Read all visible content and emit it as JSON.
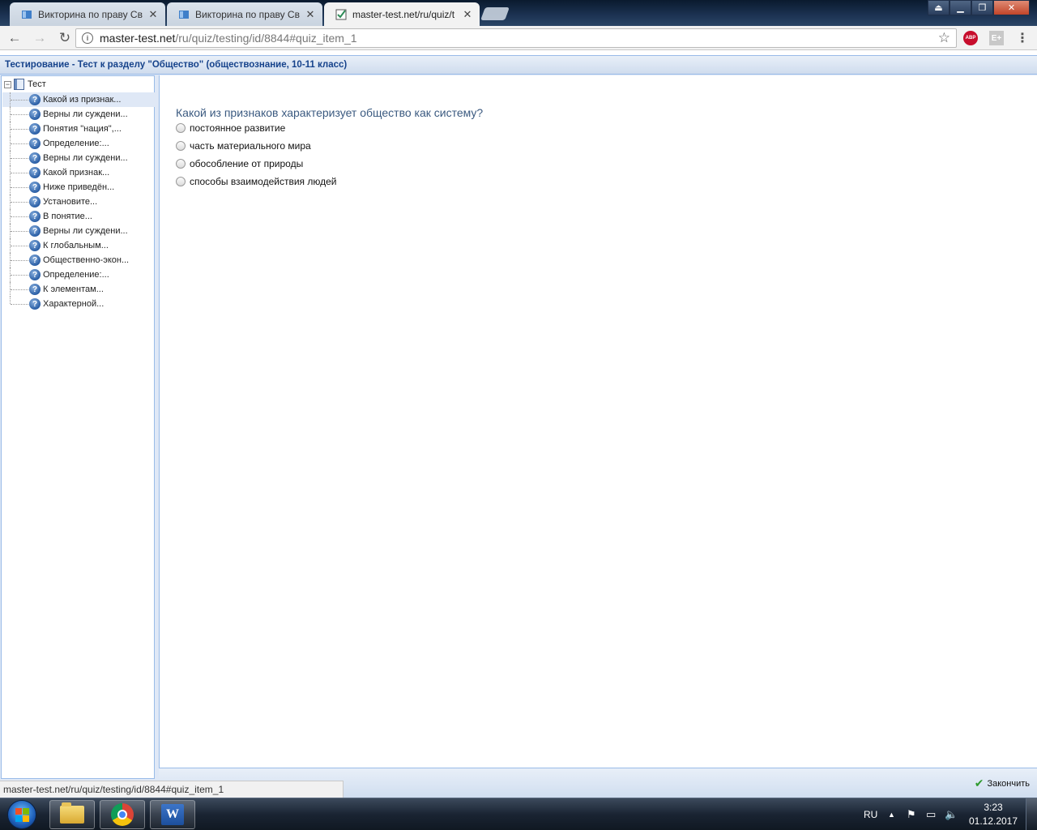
{
  "browser": {
    "tabs": [
      {
        "title": "Викторина по праву Св",
        "active": false,
        "icon": "book-icon"
      },
      {
        "title": "Викторина по праву Св",
        "active": false,
        "icon": "book-icon"
      },
      {
        "title": "master-test.net/ru/quiz/t",
        "active": true,
        "icon": "checkbox-icon"
      }
    ],
    "address": {
      "host": "master-test.net",
      "path": "/ru/quiz/testing/id/8844#quiz_item_1"
    },
    "extensions": {
      "abp": "ABP",
      "eplus": "E+"
    },
    "status_url": "master-test.net/ru/quiz/testing/id/8844#quiz_item_1"
  },
  "page": {
    "header_title": "Тестирование - Тест к разделу \"Общество\" (обществознание, 10-11 класс)",
    "tree": {
      "root_label": "Тест",
      "items": [
        "Какой из признак...",
        "Верны ли суждени...",
        "Понятия \"нация\",...",
        "Определение:...",
        "Верны ли суждени...",
        "Какой признак...",
        "Ниже приведён...",
        "Установите...",
        "В понятие...",
        "Верны ли суждени...",
        "К глобальным...",
        "Общественно-экон...",
        "Определение:...",
        "К элементам...",
        "Характерной..."
      ],
      "selected_index": 0
    },
    "question": "Какой из признаков характеризует общество как систему?",
    "answers": [
      "постоянное развитие",
      "часть материального мира",
      "обособление от природы",
      "способы взаимодействия людей"
    ],
    "finish_label": "Закончить"
  },
  "taskbar": {
    "language": "RU",
    "time": "3:23",
    "date": "01.12.2017",
    "apps": [
      "folder-icon",
      "chrome-icon",
      "word-icon"
    ]
  },
  "colors": {
    "header_text": "#15428b",
    "question_text": "#3b5a80",
    "panel_border": "#99bbe8"
  }
}
